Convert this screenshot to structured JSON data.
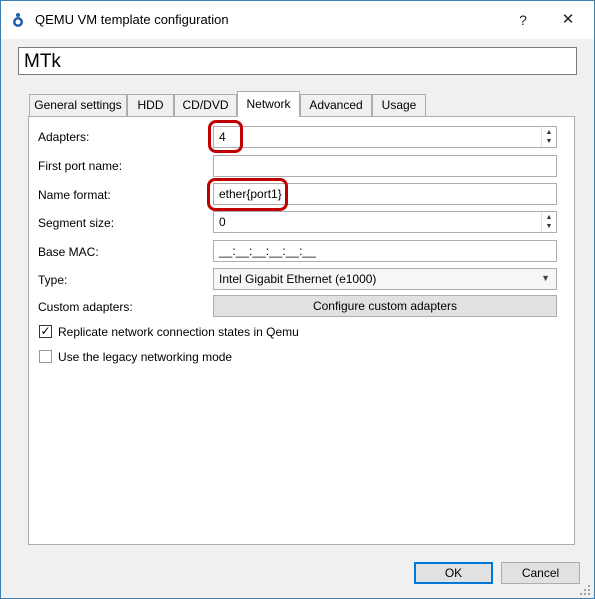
{
  "window": {
    "title": "QEMU VM template configuration",
    "help_label": "?",
    "close_label": "✕"
  },
  "template_name": "MTk",
  "tabs": [
    {
      "label": "General settings",
      "active": false
    },
    {
      "label": "HDD",
      "active": false
    },
    {
      "label": "CD/DVD",
      "active": false
    },
    {
      "label": "Network",
      "active": true
    },
    {
      "label": "Advanced",
      "active": false
    },
    {
      "label": "Usage",
      "active": false
    }
  ],
  "form": {
    "adapters": {
      "label": "Adapters:",
      "value": "4"
    },
    "first_port_name": {
      "label": "First port name:",
      "value": ""
    },
    "name_format": {
      "label": "Name format:",
      "value": "ether{port1}"
    },
    "segment_size": {
      "label": "Segment size:",
      "value": "0"
    },
    "base_mac": {
      "label": "Base MAC:",
      "value": "__:__:__:__:__:__"
    },
    "type": {
      "label": "Type:",
      "value": "Intel Gigabit Ethernet (e1000)"
    },
    "custom_adapters": {
      "label": "Custom adapters:",
      "button_label": "Configure custom adapters"
    }
  },
  "options": [
    {
      "label": "Replicate network connection states in Qemu",
      "checked": true
    },
    {
      "label": "Use the legacy networking mode",
      "checked": false
    }
  ],
  "buttons": {
    "ok": "OK",
    "cancel": "Cancel"
  },
  "icons": {
    "spin_up": "▲",
    "spin_down": "▼",
    "dropdown": "▼",
    "check": "✓"
  },
  "colors": {
    "highlight": "#c00000",
    "accent": "#0078d7"
  }
}
